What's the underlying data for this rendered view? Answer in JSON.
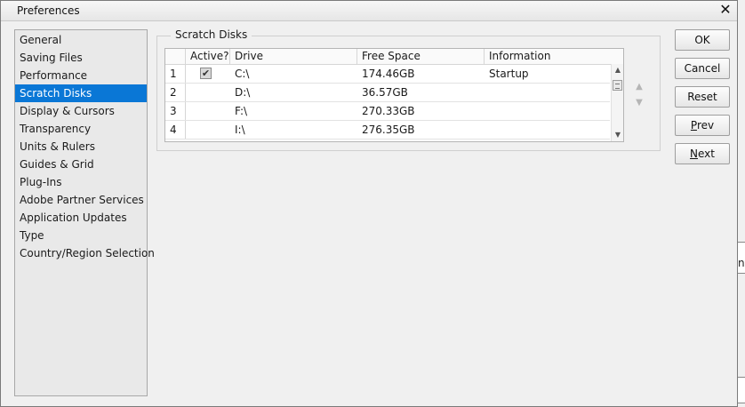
{
  "window": {
    "title": "Preferences",
    "close_glyph": "✕",
    "close_icon": "close-icon"
  },
  "sidebar": {
    "items": [
      {
        "label": "General"
      },
      {
        "label": "Saving Files"
      },
      {
        "label": "Performance"
      },
      {
        "label": "Scratch Disks",
        "selected": true
      },
      {
        "label": "Display & Cursors"
      },
      {
        "label": "Transparency"
      },
      {
        "label": "Units & Rulers"
      },
      {
        "label": "Guides & Grid"
      },
      {
        "label": "Plug-Ins"
      },
      {
        "label": "Adobe Partner Services"
      },
      {
        "label": "Application Updates"
      },
      {
        "label": "Type"
      },
      {
        "label": "Country/Region Selection"
      }
    ]
  },
  "scratch": {
    "group_label": "Scratch Disks",
    "columns": {
      "num": "",
      "active": "Active?",
      "drive": "Drive",
      "free": "Free Space",
      "info": "Information"
    },
    "rows": [
      {
        "num": "1",
        "active": true,
        "drive": "C:\\",
        "free": "174.46GB",
        "info": "Startup"
      },
      {
        "num": "2",
        "active": false,
        "drive": "D:\\",
        "free": "36.57GB",
        "info": ""
      },
      {
        "num": "3",
        "active": false,
        "drive": "F:\\",
        "free": "270.33GB",
        "info": ""
      },
      {
        "num": "4",
        "active": false,
        "drive": "I:\\",
        "free": "276.35GB",
        "info": ""
      }
    ],
    "check_glyph": "✔",
    "move_up_glyph": "▲",
    "move_down_glyph": "▼",
    "scroll_up_glyph": "▲",
    "scroll_down_glyph": "▼"
  },
  "buttons": {
    "ok": "OK",
    "cancel": "Cancel",
    "reset": "Reset",
    "prev_u": "P",
    "prev_rest": "rev",
    "next_u": "N",
    "next_rest": "ext"
  },
  "background_edge": {
    "char": "n"
  },
  "colors": {
    "selection": "#0a77d6",
    "panel": "#f0f0f0",
    "sidebar_bg": "#e9e9e9"
  }
}
